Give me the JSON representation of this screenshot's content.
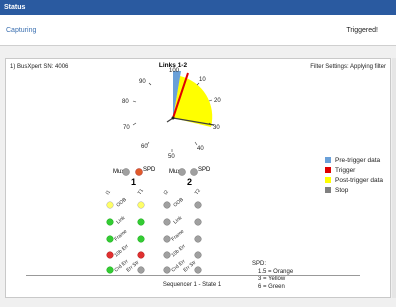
{
  "window": {
    "title": "Status"
  },
  "status": {
    "left": "Capturing",
    "right": "Triggered!"
  },
  "panel": {
    "device": "1) BusXpert SN: 4006",
    "filter": "Filter Settings: Applying filter",
    "sequencer": "Sequencer 1 - State 1"
  },
  "gauge": {
    "title": "Links 1-2",
    "ticks": [
      "100",
      "10",
      "20",
      "30",
      "40",
      "50",
      "60",
      "70",
      "80",
      "90"
    ],
    "colors": {
      "pretrigger": "#6aa0d8",
      "trigger": "#e00000",
      "posttrigger": "#ffff00",
      "stop": "#808080"
    }
  },
  "legend": {
    "items": [
      {
        "label": "Pre-trigger data",
        "color": "#6aa0d8"
      },
      {
        "label": "Trigger",
        "color": "#e00000"
      },
      {
        "label": "Post-trigger data",
        "color": "#ffff00"
      },
      {
        "label": "Stop",
        "color": "#808080"
      }
    ]
  },
  "links": {
    "mux_label": "Mux",
    "spd_label": "SPD",
    "link1_number": "1",
    "link2_number": "2",
    "col_labels_1": [
      "I1",
      "T1"
    ],
    "col_labels_2": [
      "I2",
      "T2"
    ],
    "row_labels": [
      "OOB",
      "Link",
      "Frame",
      "10b Err",
      "Crd Err",
      "Err Str"
    ]
  },
  "spd_key": {
    "title": "SPD:",
    "lines": [
      "1.5 = Orange",
      "3 = Yellow",
      "6 = Green"
    ]
  }
}
